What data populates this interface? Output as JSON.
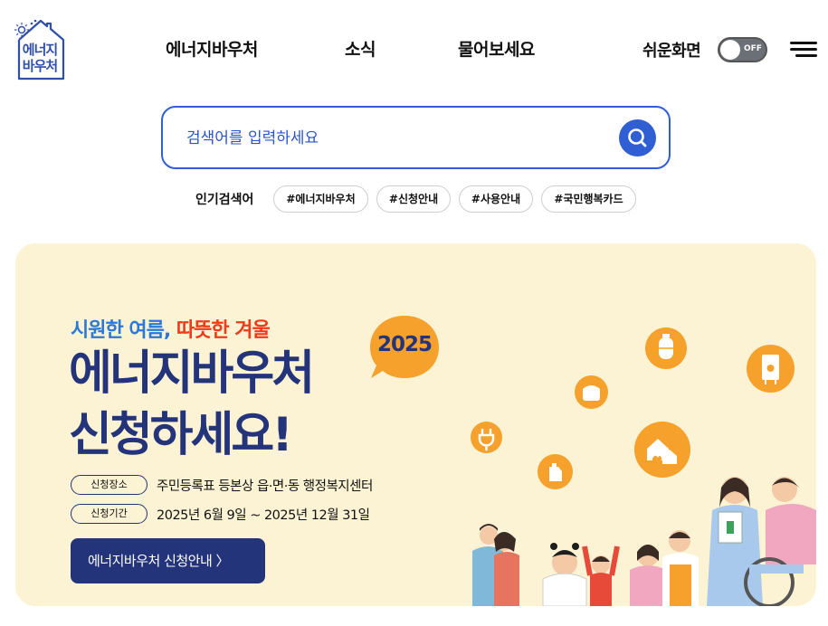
{
  "logo": {
    "line1": "에너지",
    "line2": "바우처"
  },
  "nav": {
    "items": [
      "에너지바우처",
      "소식",
      "물어보세요"
    ]
  },
  "easy_mode": {
    "label": "쉬운화면",
    "toggle_state": "OFF"
  },
  "search": {
    "placeholder": "검색어를 입력하세요"
  },
  "popular": {
    "label": "인기검색어",
    "tags": [
      "#에너지바우처",
      "#신청안내",
      "#사용안내",
      "#국민행복카드"
    ]
  },
  "banner": {
    "subtitle_blue": "시원한 여름,",
    "subtitle_red": "따뜻한 겨울",
    "title_line1": "에너지바우처",
    "title_line2": "신청하세요!",
    "year_badge": "2025",
    "place_label": "신청장소",
    "place_value": "주민등록표 등본상 읍·면·동 행정복지센터",
    "period_label": "신청기간",
    "period_value": "2025년 6월 9일 ~ 2025년 12월 31일",
    "cta": "에너지바우처 신청안내 〉",
    "icons": [
      "plug-icon",
      "gas-cylinder-icon",
      "rice-cooker-icon",
      "boiler-icon",
      "oil-can-icon",
      "houses-heat-icon"
    ]
  },
  "colors": {
    "accent": "#2f5fd3",
    "banner_bg": "#fcf3d4",
    "navy": "#24347a",
    "orange": "#f6a12b",
    "red": "#ee3b1a",
    "blue": "#2a78d8"
  }
}
